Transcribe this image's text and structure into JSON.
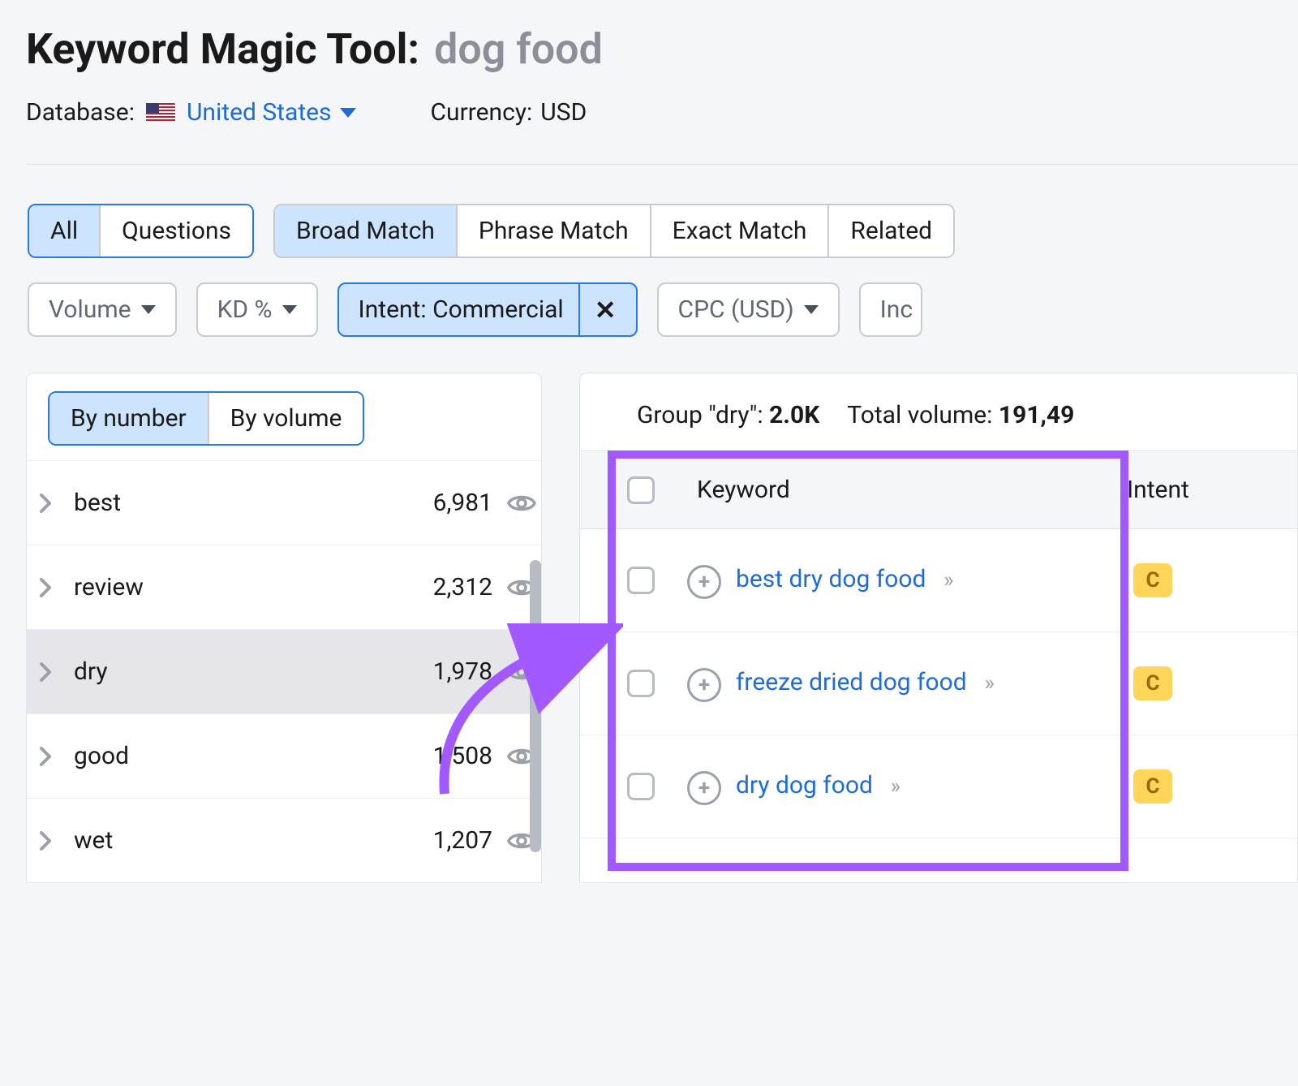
{
  "header": {
    "title_prefix": "Keyword Magic Tool:",
    "query": "dog food",
    "database_label": "Database:",
    "database_country": "United States",
    "currency_label": "Currency:",
    "currency_value": "USD"
  },
  "match_tabs": {
    "all": "All",
    "questions": "Questions",
    "broad": "Broad Match",
    "phrase": "Phrase Match",
    "exact": "Exact Match",
    "related": "Related"
  },
  "filters": {
    "volume": "Volume",
    "kd": "KD %",
    "intent": "Intent: Commercial",
    "cpc": "CPC (USD)",
    "include": "Inc"
  },
  "sidebar": {
    "sort_by_number": "By number",
    "sort_by_volume": "By volume",
    "groups": [
      {
        "name": "best",
        "count": "6,981"
      },
      {
        "name": "review",
        "count": "2,312"
      },
      {
        "name": "dry",
        "count": "1,978"
      },
      {
        "name": "good",
        "count": "1,508"
      },
      {
        "name": "wet",
        "count": "1,207"
      }
    ]
  },
  "results": {
    "group_label_prefix": "Group \"dry\":",
    "group_count": "2.0K",
    "total_volume_label": "Total volume:",
    "total_volume_value": "191,49",
    "columns": {
      "keyword": "Keyword",
      "intent": "Intent"
    },
    "rows": [
      {
        "keyword": "best dry dog food",
        "intent": "C"
      },
      {
        "keyword": "freeze dried dog food",
        "intent": "C"
      },
      {
        "keyword": "dry dog food",
        "intent": "C"
      }
    ]
  }
}
